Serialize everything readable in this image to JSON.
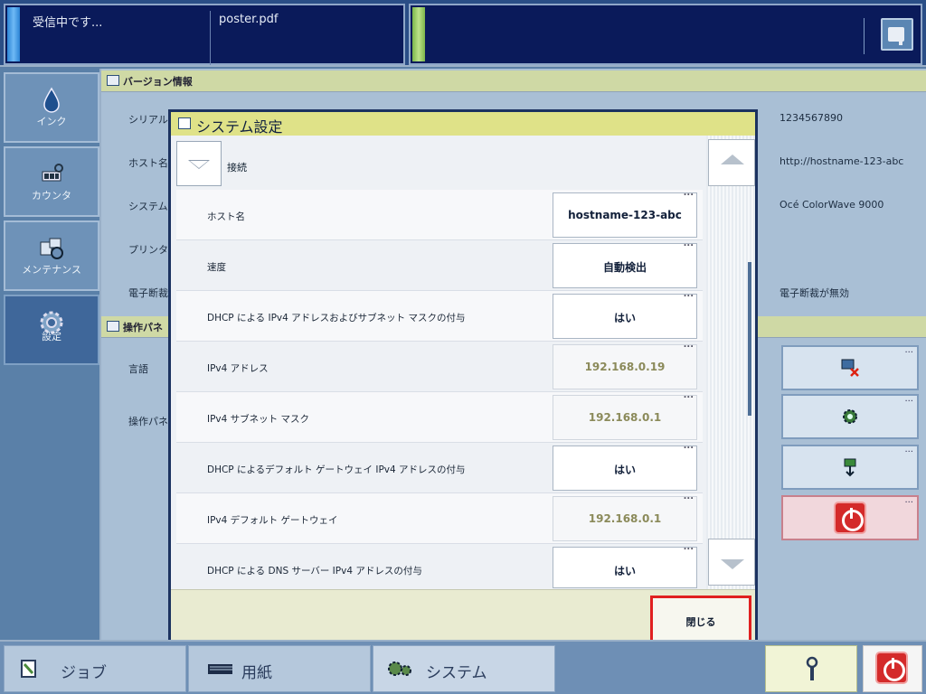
{
  "topbar": {
    "job_status": "受信中です...",
    "job_file": "poster.pdf"
  },
  "sidebar": {
    "items": [
      {
        "label": "インク",
        "icon": "ink-drop-icon"
      },
      {
        "label": "カウンタ",
        "icon": "counter-icon"
      },
      {
        "label": "メンテナンス",
        "icon": "maintenance-icon"
      },
      {
        "label": "設定",
        "icon": "settings-gear-icon"
      }
    ]
  },
  "background": {
    "version_section": "バージョン情報",
    "panel_section": "操作パネ",
    "rows": [
      {
        "label": "シリアル",
        "value": "1234567890"
      },
      {
        "label": "ホスト名",
        "value": "http://hostname-123-abc"
      },
      {
        "label": "システム",
        "value": "Océ ColorWave 9000"
      },
      {
        "label": "プリンタ",
        "value": ""
      },
      {
        "label": "電子断裁",
        "value": "電子断裁が無効"
      }
    ],
    "panel_rows": [
      {
        "label": "言語"
      },
      {
        "label": "操作パネ"
      }
    ]
  },
  "dialog": {
    "title": "システム設定",
    "section": "接続",
    "close_label": "閉じる",
    "rows": [
      {
        "label": "ホスト名",
        "value": "hostname-123-abc",
        "readonly": false
      },
      {
        "label": "速度",
        "value": "自動検出",
        "readonly": false
      },
      {
        "label": "DHCP による IPv4 アドレスおよびサブネット マスクの付与",
        "value": "はい",
        "readonly": false
      },
      {
        "label": "IPv4 アドレス",
        "value": "192.168.0.19",
        "readonly": true
      },
      {
        "label": "IPv4 サブネット マスク",
        "value": "192.168.0.1",
        "readonly": true
      },
      {
        "label": "DHCP によるデフォルト ゲートウェイ IPv4 アドレスの付与",
        "value": "はい",
        "readonly": false
      },
      {
        "label": "IPv4 デフォルト ゲートウェイ",
        "value": "192.168.0.1",
        "readonly": true
      },
      {
        "label": "DHCP による DNS サーバー IPv4 アドレスの付与",
        "value": "はい",
        "readonly": false
      }
    ]
  },
  "bottombar": {
    "tabs": [
      {
        "label": "ジョブ",
        "icon": "job-icon"
      },
      {
        "label": "用紙",
        "icon": "paper-icon"
      },
      {
        "label": "システム",
        "icon": "system-gears-icon"
      }
    ]
  },
  "colors": {
    "accent_title": "#dfe288",
    "close_highlight": "#e02020",
    "power_red": "#d42a2a"
  }
}
